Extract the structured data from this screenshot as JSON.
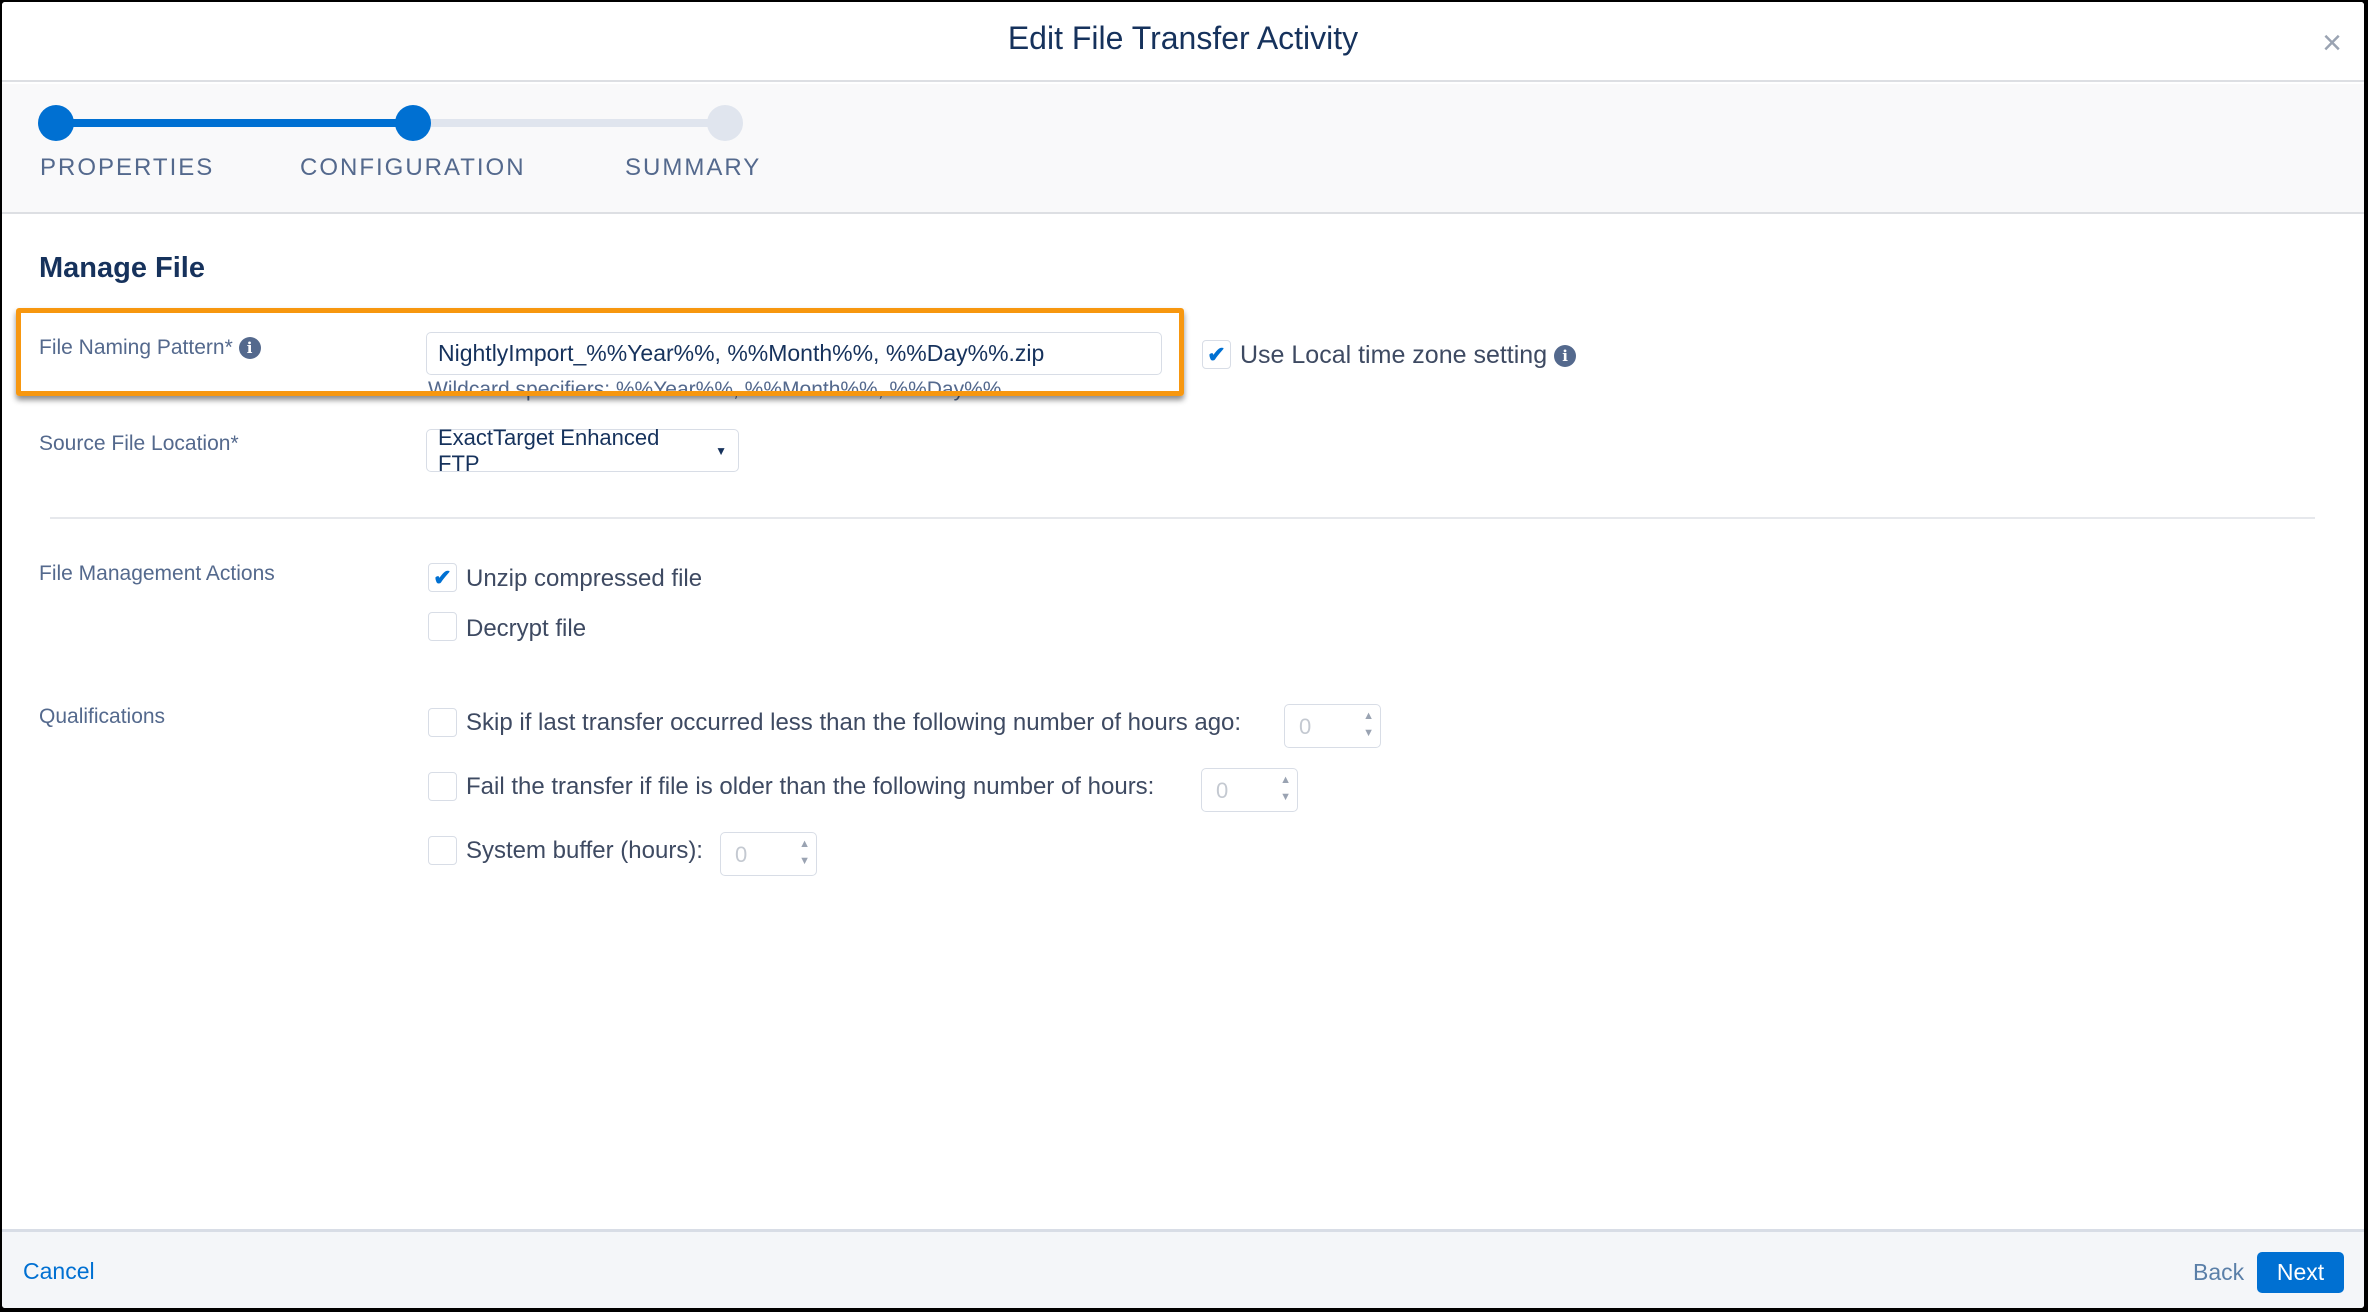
{
  "dialog": {
    "title": "Edit File Transfer Activity",
    "close_icon": "close-icon"
  },
  "stepper": {
    "steps": [
      {
        "label": "PROPERTIES",
        "state": "complete"
      },
      {
        "label": "CONFIGURATION",
        "state": "current"
      },
      {
        "label": "SUMMARY",
        "state": "upcoming"
      }
    ],
    "colors": {
      "active": "#0070d2",
      "inactive": "#e0e5ee"
    }
  },
  "section": {
    "title": "Manage File"
  },
  "file_naming": {
    "label": "File Naming Pattern*",
    "value": "NightlyImport_%%Year%%, %%Month%%, %%Day%%.zip",
    "help": "Wildcard specifiers: %%Year%%, %%Month%%, %%Day%%",
    "local_tz_label": "Use Local time zone setting",
    "local_tz_checked": true,
    "highlight_color": "#f7970f"
  },
  "source": {
    "label": "Source File Location*",
    "value": "ExactTarget Enhanced FTP"
  },
  "actions": {
    "label": "File Management Actions",
    "unzip": {
      "label": "Unzip compressed file",
      "checked": true
    },
    "decrypt": {
      "label": "Decrypt file",
      "checked": false
    }
  },
  "qualifications": {
    "label": "Qualifications",
    "items": [
      {
        "label": "Skip if last transfer occurred less than the following number of hours ago:",
        "checked": false,
        "value": "0"
      },
      {
        "label": "Fail the transfer if file is older than the following number of hours:",
        "checked": false,
        "value": "0"
      },
      {
        "label": "System buffer (hours):",
        "checked": false,
        "value": "0"
      }
    ]
  },
  "footer": {
    "cancel": "Cancel",
    "back": "Back",
    "next": "Next"
  }
}
